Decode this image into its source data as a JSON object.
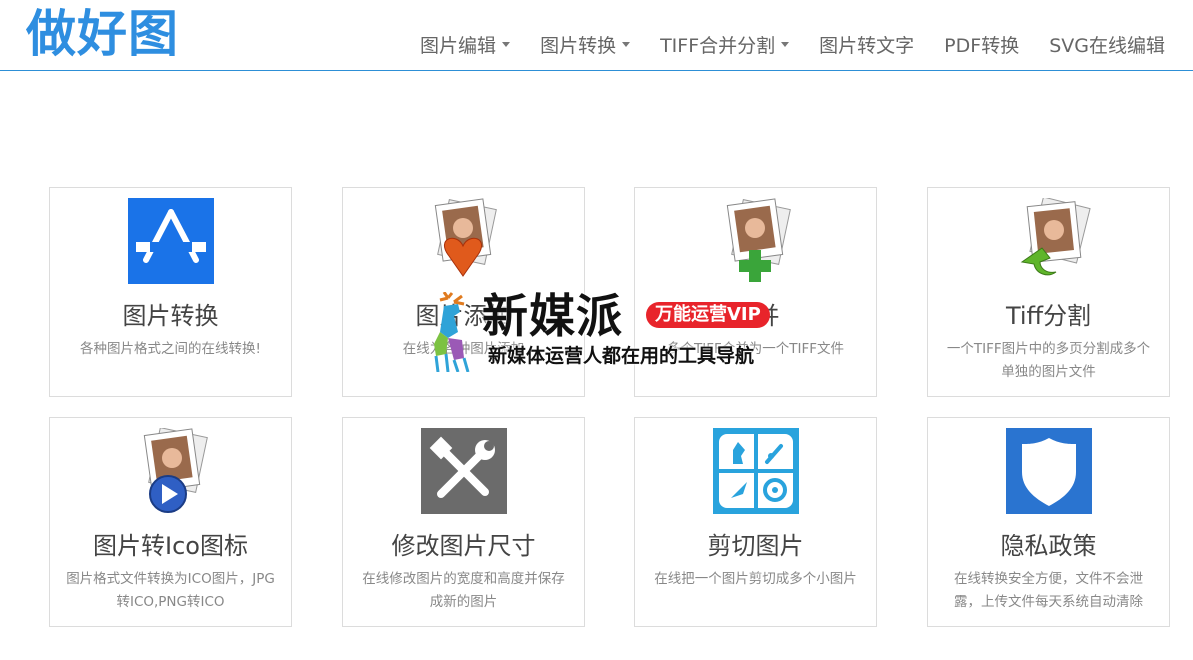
{
  "header": {
    "logo": "做好图",
    "nav": [
      {
        "label": "图片编辑",
        "dropdown": true
      },
      {
        "label": "图片转换",
        "dropdown": true
      },
      {
        "label": "TIFF合并分割",
        "dropdown": true
      },
      {
        "label": "图片转文字",
        "dropdown": false
      },
      {
        "label": "PDF转换",
        "dropdown": false
      },
      {
        "label": "SVG在线编辑",
        "dropdown": false
      }
    ]
  },
  "cards": [
    {
      "title": "图片转换",
      "desc": "各种图片格式之间的在线转换!",
      "icon": "app-store-icon"
    },
    {
      "title": "图片添加",
      "desc": "在线为各种图片添加",
      "icon": "photo-heart-icon"
    },
    {
      "title": "合并",
      "desc": "多个TIFF合并为一个TIFF文件",
      "icon": "photo-plus-icon"
    },
    {
      "title": "Tiff分割",
      "desc": "一个TIFF图片中的多页分割成多个单独的图片文件",
      "icon": "photo-arrow-icon"
    },
    {
      "title": "图片转Ico图标",
      "desc": "图片格式文件转换为ICO图片，JPG转ICO,PNG转ICO",
      "icon": "photo-play-icon"
    },
    {
      "title": "修改图片尺寸",
      "desc": "在线修改图片的宽度和高度并保存成新的图片",
      "icon": "tools-icon"
    },
    {
      "title": "剪切图片",
      "desc": "在线把一个图片剪切成多个小图片",
      "icon": "grid-tiles-icon"
    },
    {
      "title": "隐私政策",
      "desc": "在线转换安全方便，文件不会泄露，上传文件每天系统自动清除",
      "icon": "shield-icon"
    }
  ],
  "overlay": {
    "brand": "新媒派",
    "badge": "万能运营VIP",
    "tagline": "新媒体运营人都在用的工具导航"
  },
  "colors": {
    "accent": "#2e8ee0",
    "blue_tile": "#1a73e8",
    "tool_tile": "#6b6b6b",
    "cyan_tile": "#29a3dd",
    "shield_tile": "#2a74d0"
  }
}
